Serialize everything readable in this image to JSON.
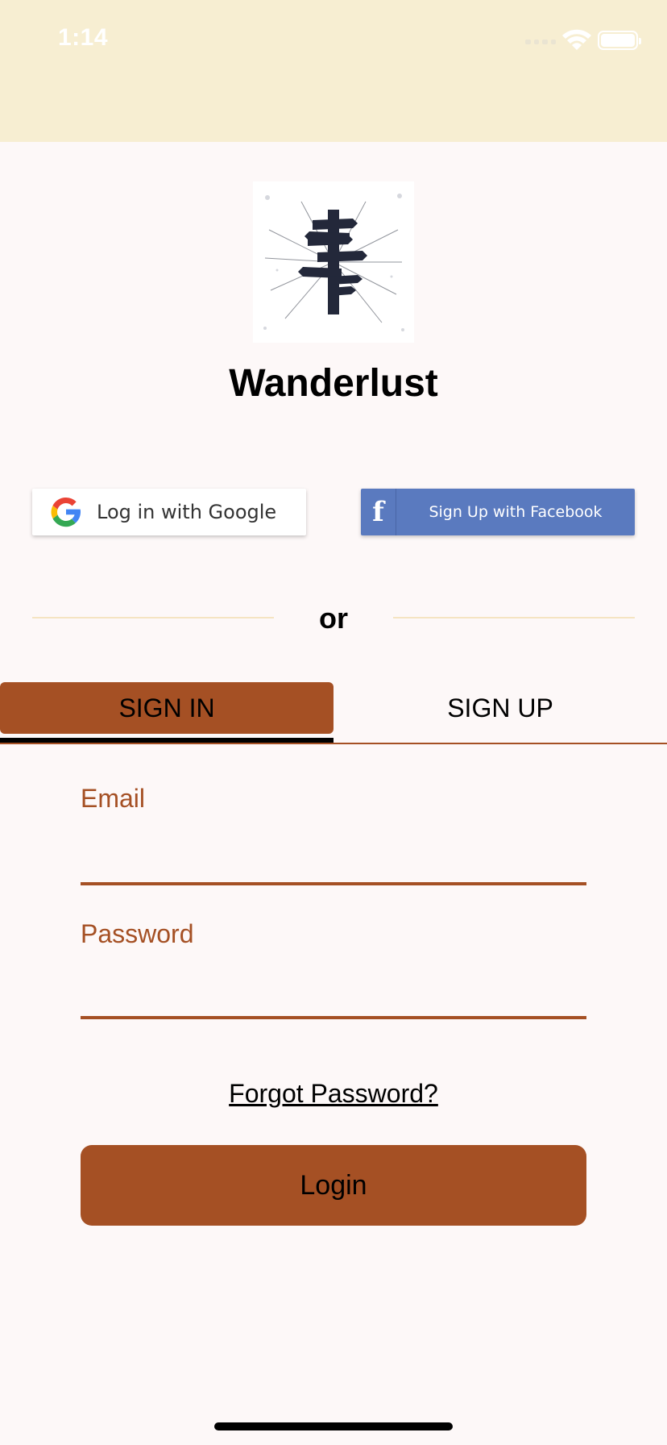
{
  "status_bar": {
    "time": "1:14",
    "icons": [
      "cellular-signal-icon",
      "wifi-icon",
      "battery-icon"
    ]
  },
  "app": {
    "title": "Wanderlust",
    "logo_icon": "signpost-logo-icon"
  },
  "social": {
    "google_label": "Log in with Google",
    "facebook_label": "Sign Up with Facebook",
    "facebook_icon": "f"
  },
  "divider": {
    "text": "or"
  },
  "tabs": [
    {
      "label": "SIGN IN",
      "selected": true
    },
    {
      "label": "SIGN UP",
      "selected": false
    }
  ],
  "form": {
    "email_label": "Email",
    "email_value": "",
    "password_label": "Password",
    "password_value": "",
    "forgot_label": "Forgot Password?",
    "login_label": "Login"
  },
  "colors": {
    "accent": "#a55024",
    "status_bar_bg": "#f7eed2",
    "background": "#fdf8f8",
    "facebook_blue": "#5a7abf"
  }
}
